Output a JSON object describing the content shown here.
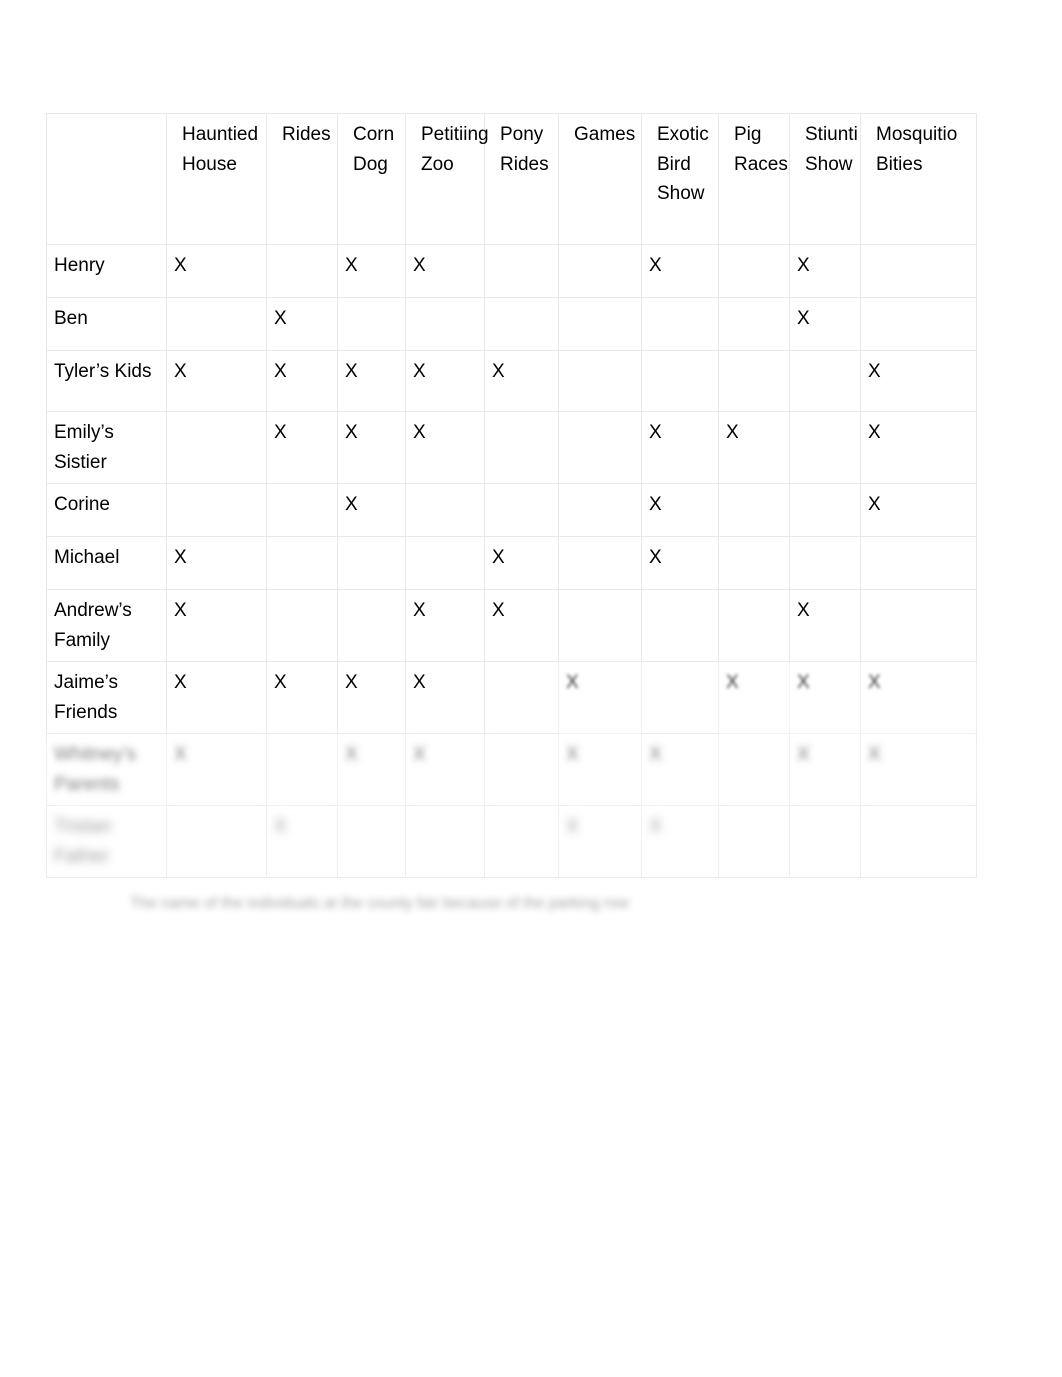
{
  "document": {
    "type": "attendance-matrix-table",
    "caption": "The name of the individuals at the county fair because of the parking row"
  },
  "table": {
    "corner_label": "",
    "column_headers": [
      "Hauntied House",
      "Rides",
      "Corn Dog",
      "Petitiing Zoo",
      "Pony Rides",
      "Games",
      "Exotic Bird Show",
      "Pig Races",
      "Stiunti Show",
      "Mosquitio Bities"
    ],
    "mark_symbol": "X",
    "rows": [
      {
        "label": "Henry",
        "blur": "none",
        "marks": [
          "X",
          "",
          "X",
          "X",
          "",
          "",
          "X",
          "",
          "X",
          ""
        ]
      },
      {
        "label": "Ben",
        "blur": "none",
        "marks": [
          "",
          "X",
          "",
          "",
          "",
          "",
          "",
          "",
          "X",
          ""
        ]
      },
      {
        "label": "Tyler’s Kids",
        "blur": "none",
        "marks": [
          "X",
          "X",
          "X",
          "X",
          "X",
          "",
          "",
          "",
          "",
          "X"
        ]
      },
      {
        "label": "Emily’s Sistier",
        "blur": "none",
        "marks": [
          "",
          "X",
          "X",
          "X",
          "",
          "",
          "X",
          "X",
          "",
          "X"
        ]
      },
      {
        "label": "Corine",
        "blur": "none",
        "marks": [
          "",
          "",
          "X",
          "",
          "",
          "",
          "X",
          "",
          "",
          "X"
        ]
      },
      {
        "label": "Michael",
        "blur": "none",
        "marks": [
          "X",
          "",
          "",
          "",
          "X",
          "",
          "X",
          "",
          "",
          ""
        ]
      },
      {
        "label": "Andrew’s Family",
        "blur": "none",
        "marks": [
          "X",
          "",
          "",
          "X",
          "X",
          "",
          "",
          "",
          "X",
          ""
        ]
      },
      {
        "label": "Jaime’s Friends",
        "blur": "none",
        "marks": [
          "X",
          "X",
          "X",
          "X",
          "",
          "X",
          "",
          "X",
          "X",
          "X"
        ]
      },
      {
        "label": "Whitney’s Parents",
        "blur": "heavy",
        "marks": [
          "X",
          "",
          "X",
          "X",
          "",
          "X",
          "X",
          "",
          "X",
          "X"
        ]
      },
      {
        "label": "Tristan Father",
        "blur": "heavy",
        "marks": [
          "",
          "X",
          "",
          "",
          "",
          "X",
          "X",
          "",
          "",
          ""
        ]
      }
    ]
  }
}
